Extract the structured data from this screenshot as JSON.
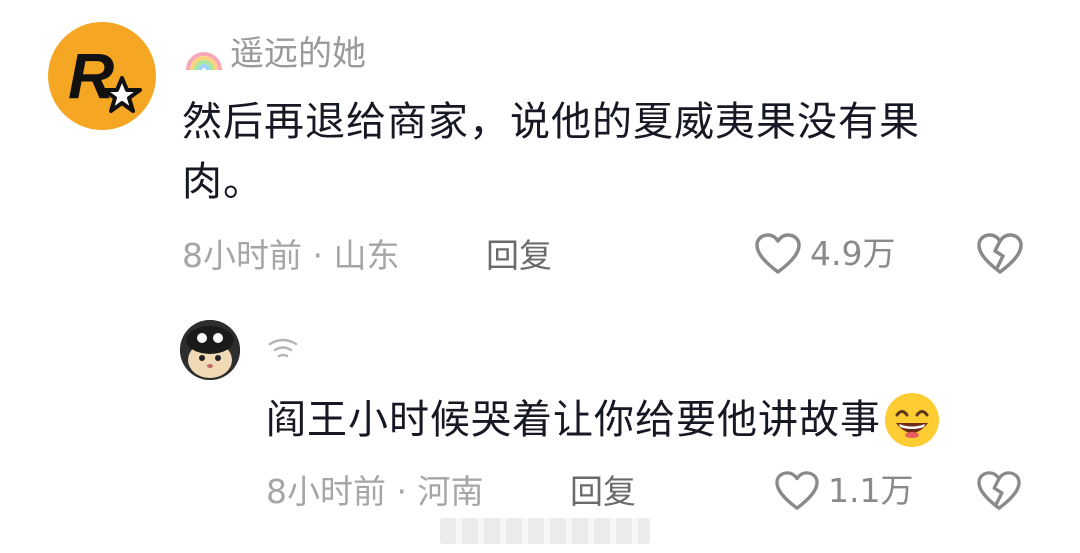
{
  "comments": [
    {
      "username": "遥远的她",
      "username_prefix_icon": "rainbow-icon",
      "avatar_icon": "rockstar-logo",
      "text_line1": "然后再退给商家，说他的夏威夷果没有果",
      "text_line2": "肉。",
      "time_location": "8小时前 · 山东",
      "reply_label": "回复",
      "like_count": "4.9万",
      "like_icon": "heart-outline-icon",
      "dislike_icon": "broken-heart-icon"
    },
    {
      "username": "",
      "username_icon": "wifi-icon",
      "avatar_icon": "cat-avatar",
      "text": "阎王小时候哭着让你给要他讲故事",
      "emoji": "grinning-face-emoji",
      "time_location": "8小时前 · 河南",
      "reply_label": "回复",
      "like_count": "1.1万",
      "like_icon": "heart-outline-icon",
      "dislike_icon": "broken-heart-icon"
    }
  ],
  "colors": {
    "text_primary": "#161823",
    "text_secondary": "#a6a6a6",
    "avatar_yellow": "#f5a623"
  }
}
